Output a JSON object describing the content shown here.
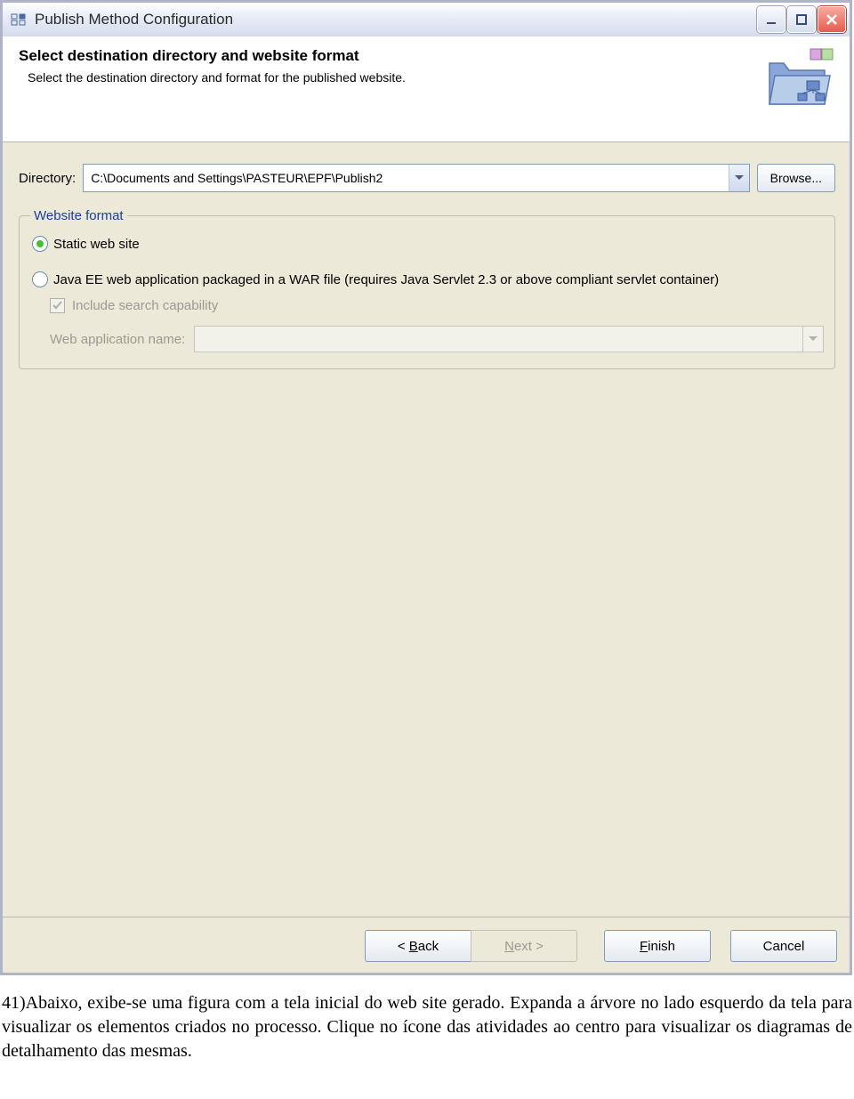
{
  "titlebar": {
    "title": "Publish Method Configuration"
  },
  "banner": {
    "heading": "Select destination directory and website format",
    "subheading": "Select the destination directory and format for the published website."
  },
  "form": {
    "directory_label": "Directory:",
    "directory_value": "C:\\Documents and Settings\\PASTEUR\\EPF\\Publish2",
    "browse_label": "Browse...",
    "group_legend": "Website format",
    "radio_static": "Static web site",
    "radio_war": "Java EE web application packaged in a WAR file (requires Java Servlet 2.3 or above compliant servlet container)",
    "include_search": "Include search capability",
    "webapp_label": "Web application name:"
  },
  "buttons": {
    "back": "< Back",
    "next": "Next >",
    "finish": "Finish",
    "cancel": "Cancel"
  },
  "caption": {
    "text": "41)Abaixo, exibe-se uma figura com a tela inicial do web site gerado. Expanda a árvore no lado esquerdo da tela para visualizar os elementos criados no processo. Clique no ícone das atividades ao centro para visualizar os diagramas de detalhamento das mesmas."
  }
}
